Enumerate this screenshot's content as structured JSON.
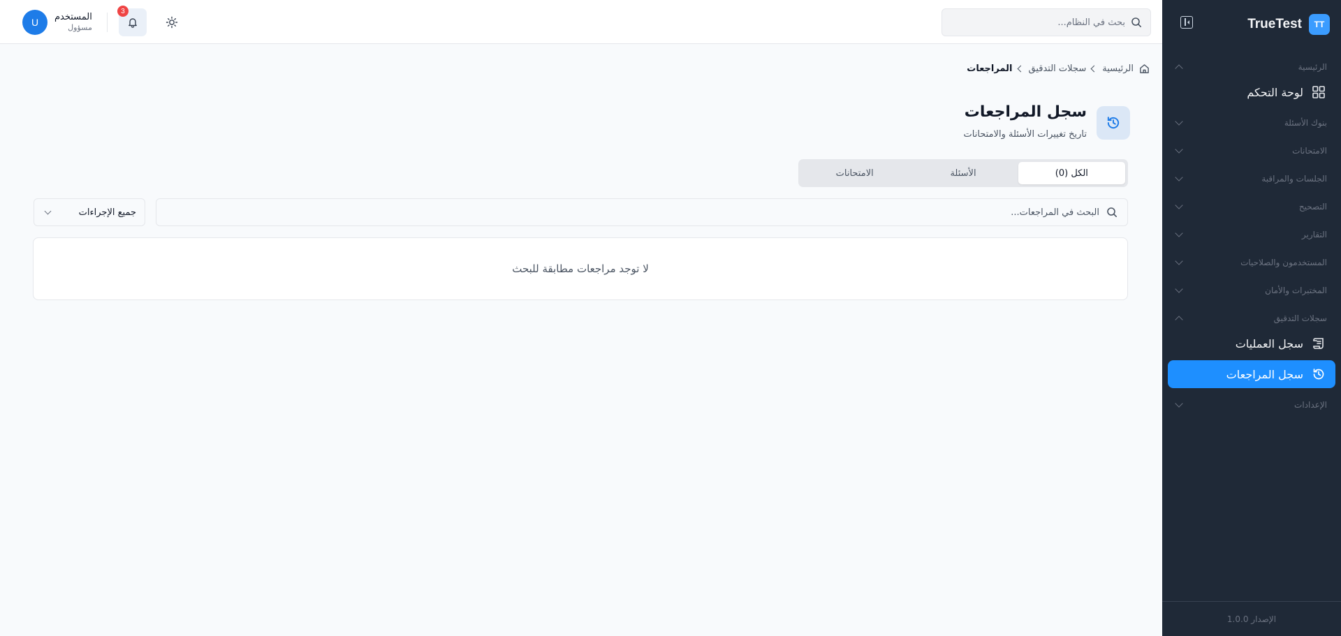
{
  "sidebar": {
    "logo": "TT",
    "brand": "TrueTest",
    "sections": {
      "home": "الرئيسية",
      "question_banks": "بنوك الأسئلة",
      "exams": "الامتحانات",
      "sessions": "الجلسات والمراقبة",
      "grading": "التصحيح",
      "reports": "التقارير",
      "users": "المستخدمون والصلاحيات",
      "labs": "المختبرات والأمان",
      "audit": "سجلات التدقيق",
      "settings": "الإعدادات"
    },
    "items": {
      "dashboard": "لوحة التحكم",
      "operations_log": "سجل العمليات",
      "revisions_log": "سجل المراجعات"
    },
    "version": "الإصدار 1.0.0"
  },
  "topbar": {
    "search_placeholder": "بحث في النظام...",
    "notifications_count": "3",
    "user_name": "المستخدم",
    "user_role": "مسؤول",
    "avatar_initial": "U"
  },
  "breadcrumb": {
    "home": "الرئيسية",
    "audit": "سجلات التدقيق",
    "current": "المراجعات"
  },
  "page": {
    "title": "سجل المراجعات",
    "subtitle": "تاريخ تغييرات الأسئلة والامتحانات"
  },
  "tabs": {
    "all": "الكل (0)",
    "questions": "الأسئلة",
    "exams": "الامتحانات"
  },
  "filters": {
    "search_placeholder": "البحث في المراجعات...",
    "action_select": "جميع الإجراءات"
  },
  "empty_message": "لا توجد مراجعات مطابقة للبحث",
  "colors": {
    "sidebar_bg": "#1f2937",
    "accent": "#1e8fff",
    "badge": "#ef4444"
  }
}
